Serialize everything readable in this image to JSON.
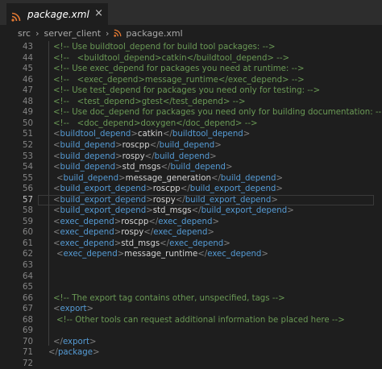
{
  "tab": {
    "title": "package.xml",
    "close": "×"
  },
  "breadcrumb": [
    "src",
    "server_client",
    "package.xml"
  ],
  "colors": {
    "comment": "#6a9955",
    "tag": "#569cd6",
    "bracket": "#808080",
    "text": "#d4d4d4"
  },
  "lines": [
    {
      "n": "43",
      "indent": 0,
      "parts": [
        [
          "c",
          "<!-- Use buildtool_depend for build tool packages: -->"
        ]
      ]
    },
    {
      "n": "44",
      "indent": 0,
      "parts": [
        [
          "c",
          "<!--   <buildtool_depend>catkin</buildtool_depend> -->"
        ]
      ]
    },
    {
      "n": "45",
      "indent": 0,
      "parts": [
        [
          "c",
          "<!-- Use exec_depend for packages you need at runtime: -->"
        ]
      ]
    },
    {
      "n": "46",
      "indent": 0,
      "parts": [
        [
          "c",
          "<!--   <exec_depend>message_runtime</exec_depend> -->"
        ]
      ]
    },
    {
      "n": "47",
      "indent": 0,
      "parts": [
        [
          "c",
          "<!-- Use test_depend for packages you need only for testing: -->"
        ]
      ]
    },
    {
      "n": "48",
      "indent": 0,
      "parts": [
        [
          "c",
          "<!--   <test_depend>gtest</test_depend> -->"
        ]
      ]
    },
    {
      "n": "49",
      "indent": 0,
      "parts": [
        [
          "c",
          "<!-- Use doc_depend for packages you need only for building documentation: -->"
        ]
      ]
    },
    {
      "n": "50",
      "indent": 0,
      "parts": [
        [
          "c",
          "<!--   <doc_depend>doxygen</doc_depend> -->"
        ]
      ]
    },
    {
      "n": "51",
      "indent": 0,
      "parts": [
        [
          "b",
          "<"
        ],
        [
          "t",
          "buildtool_depend"
        ],
        [
          "b",
          ">"
        ],
        [
          "x",
          "catkin"
        ],
        [
          "b",
          "</"
        ],
        [
          "t",
          "buildtool_depend"
        ],
        [
          "b",
          ">"
        ]
      ]
    },
    {
      "n": "52",
      "indent": 0,
      "parts": [
        [
          "b",
          "<"
        ],
        [
          "t",
          "build_depend"
        ],
        [
          "b",
          ">"
        ],
        [
          "x",
          "roscpp"
        ],
        [
          "b",
          "</"
        ],
        [
          "t",
          "build_depend"
        ],
        [
          "b",
          ">"
        ]
      ]
    },
    {
      "n": "53",
      "indent": 0,
      "parts": [
        [
          "b",
          "<"
        ],
        [
          "t",
          "build_depend"
        ],
        [
          "b",
          ">"
        ],
        [
          "x",
          "rospy"
        ],
        [
          "b",
          "</"
        ],
        [
          "t",
          "build_depend"
        ],
        [
          "b",
          ">"
        ]
      ]
    },
    {
      "n": "54",
      "indent": 0,
      "parts": [
        [
          "b",
          "<"
        ],
        [
          "t",
          "build_depend"
        ],
        [
          "b",
          ">"
        ],
        [
          "x",
          "std_msgs"
        ],
        [
          "b",
          "</"
        ],
        [
          "t",
          "build_depend"
        ],
        [
          "b",
          ">"
        ]
      ]
    },
    {
      "n": "55",
      "indent": 1,
      "parts": [
        [
          "b",
          "<"
        ],
        [
          "t",
          "build_depend"
        ],
        [
          "b",
          ">"
        ],
        [
          "x",
          "message_generation"
        ],
        [
          "b",
          "</"
        ],
        [
          "t",
          "build_depend"
        ],
        [
          "b",
          ">"
        ]
      ]
    },
    {
      "n": "56",
      "indent": 0,
      "parts": [
        [
          "b",
          "<"
        ],
        [
          "t",
          "build_export_depend"
        ],
        [
          "b",
          ">"
        ],
        [
          "x",
          "roscpp"
        ],
        [
          "b",
          "</"
        ],
        [
          "t",
          "build_export_depend"
        ],
        [
          "b",
          ">"
        ]
      ]
    },
    {
      "n": "57",
      "indent": 0,
      "parts": [
        [
          "b",
          "<"
        ],
        [
          "t",
          "build_export_depend"
        ],
        [
          "b",
          ">"
        ],
        [
          "x",
          "rospy"
        ],
        [
          "b",
          "</"
        ],
        [
          "t",
          "build_export_depend"
        ],
        [
          "b",
          ">"
        ]
      ]
    },
    {
      "n": "58",
      "indent": 0,
      "parts": [
        [
          "b",
          "<"
        ],
        [
          "t",
          "build_export_depend"
        ],
        [
          "b",
          ">"
        ],
        [
          "x",
          "std_msgs"
        ],
        [
          "b",
          "</"
        ],
        [
          "t",
          "build_export_depend"
        ],
        [
          "b",
          ">"
        ]
      ]
    },
    {
      "n": "59",
      "indent": 0,
      "parts": [
        [
          "b",
          "<"
        ],
        [
          "t",
          "exec_depend"
        ],
        [
          "b",
          ">"
        ],
        [
          "x",
          "roscpp"
        ],
        [
          "b",
          "</"
        ],
        [
          "t",
          "exec_depend"
        ],
        [
          "b",
          ">"
        ]
      ]
    },
    {
      "n": "60",
      "indent": 0,
      "parts": [
        [
          "b",
          "<"
        ],
        [
          "t",
          "exec_depend"
        ],
        [
          "b",
          ">"
        ],
        [
          "x",
          "rospy"
        ],
        [
          "b",
          "</"
        ],
        [
          "t",
          "exec_depend"
        ],
        [
          "b",
          ">"
        ]
      ]
    },
    {
      "n": "61",
      "indent": 0,
      "parts": [
        [
          "b",
          "<"
        ],
        [
          "t",
          "exec_depend"
        ],
        [
          "b",
          ">"
        ],
        [
          "x",
          "std_msgs"
        ],
        [
          "b",
          "</"
        ],
        [
          "t",
          "exec_depend"
        ],
        [
          "b",
          ">"
        ]
      ]
    },
    {
      "n": "62",
      "indent": 1,
      "parts": [
        [
          "b",
          "<"
        ],
        [
          "t",
          "exec_depend"
        ],
        [
          "b",
          ">"
        ],
        [
          "x",
          "message_runtime"
        ],
        [
          "b",
          "</"
        ],
        [
          "t",
          "exec_depend"
        ],
        [
          "b",
          ">"
        ]
      ]
    },
    {
      "n": "63",
      "indent": 0,
      "parts": []
    },
    {
      "n": "64",
      "indent": 0,
      "parts": []
    },
    {
      "n": "65",
      "indent": 0,
      "parts": []
    },
    {
      "n": "66",
      "indent": 0,
      "parts": [
        [
          "c",
          "<!-- The export tag contains other, unspecified, tags -->"
        ]
      ]
    },
    {
      "n": "67",
      "indent": 0,
      "parts": [
        [
          "b",
          "<"
        ],
        [
          "t",
          "export"
        ],
        [
          "b",
          ">"
        ]
      ]
    },
    {
      "n": "68",
      "indent": 1,
      "parts": [
        [
          "c",
          "<!-- Other tools can request additional information be placed here -->"
        ]
      ]
    },
    {
      "n": "69",
      "indent": 0,
      "parts": []
    },
    {
      "n": "70",
      "indent": 0,
      "parts": [
        [
          "b",
          "</"
        ],
        [
          "t",
          "export"
        ],
        [
          "b",
          ">"
        ]
      ]
    },
    {
      "n": "71",
      "indent": -1,
      "parts": [
        [
          "b",
          "</"
        ],
        [
          "t",
          "package"
        ],
        [
          "b",
          ">"
        ]
      ]
    },
    {
      "n": "72",
      "indent": 0,
      "parts": []
    }
  ],
  "current_line": "57"
}
